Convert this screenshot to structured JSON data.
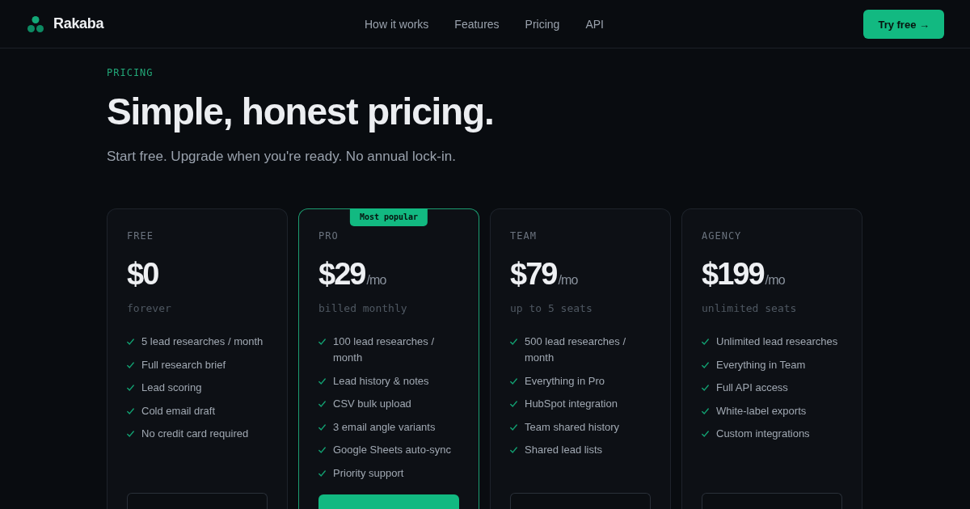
{
  "nav": {
    "brand": "Rakaba",
    "links": [
      {
        "label": "How it works"
      },
      {
        "label": "Features"
      },
      {
        "label": "Pricing"
      },
      {
        "label": "API"
      }
    ],
    "cta": "Try free →"
  },
  "hero": {
    "eyebrow": "PRICING",
    "title": "Simple, honest pricing.",
    "subtitle": "Start free. Upgrade when you're ready. No annual lock-in."
  },
  "plans": [
    {
      "name": "FREE",
      "price": "$0",
      "note": "forever",
      "featured": false,
      "features": [
        "5 lead researches / month",
        "Full research brief",
        "Lead scoring",
        "Cold email draft",
        "No credit card required"
      ],
      "button": {
        "kind": "secondary"
      }
    },
    {
      "name": "PRO",
      "badge": "Most popular",
      "price": "$29",
      "period": "/mo",
      "note": "billed monthly",
      "featured": true,
      "features": [
        "100 lead researches / month",
        "Lead history & notes",
        "CSV bulk upload",
        "3 email angle variants",
        "Google Sheets auto-sync",
        "Priority support"
      ],
      "button": {
        "kind": "primary"
      }
    },
    {
      "name": "TEAM",
      "price": "$79",
      "period": "/mo",
      "note": "up to 5 seats",
      "featured": false,
      "features": [
        "500 lead researches / month",
        "Everything in Pro",
        "HubSpot integration",
        "Team shared history",
        "Shared lead lists"
      ],
      "button": {
        "kind": "secondary"
      }
    },
    {
      "name": "AGENCY",
      "price": "$199",
      "period": "/mo",
      "note": "unlimited seats",
      "featured": false,
      "features": [
        "Unlimited lead researches",
        "Everything in Team",
        "Full API access",
        "White-label exports",
        "Custom integrations"
      ],
      "button": {
        "kind": "secondary"
      }
    }
  ]
}
